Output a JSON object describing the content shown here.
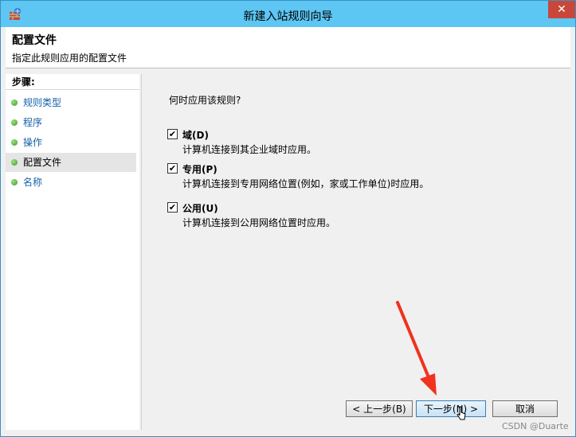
{
  "window": {
    "title": "新建入站规则向导",
    "close": "✕"
  },
  "header": {
    "title": "配置文件",
    "description": "指定此规则应用的配置文件"
  },
  "steps": {
    "heading": "步骤:",
    "items": [
      {
        "label": "规则类型"
      },
      {
        "label": "程序"
      },
      {
        "label": "操作"
      },
      {
        "label": "配置文件"
      },
      {
        "label": "名称"
      }
    ]
  },
  "main": {
    "question": "何时应用该规则?",
    "options": [
      {
        "label": "域(D)",
        "desc": "计算机连接到其企业域时应用。",
        "checked": true
      },
      {
        "label": "专用(P)",
        "desc": "计算机连接到专用网络位置(例如，家或工作单位)时应用。",
        "checked": true
      },
      {
        "label": "公用(U)",
        "desc": "计算机连接到公用网络位置时应用。",
        "checked": true
      }
    ]
  },
  "buttons": {
    "back": "< 上一步(B)",
    "next": "下一步(N) >",
    "cancel": "取消"
  },
  "watermark": "CSDN @Duarte",
  "colors": {
    "titlebar": "#5dc6f3",
    "annotation_arrow": "#f0321e"
  }
}
